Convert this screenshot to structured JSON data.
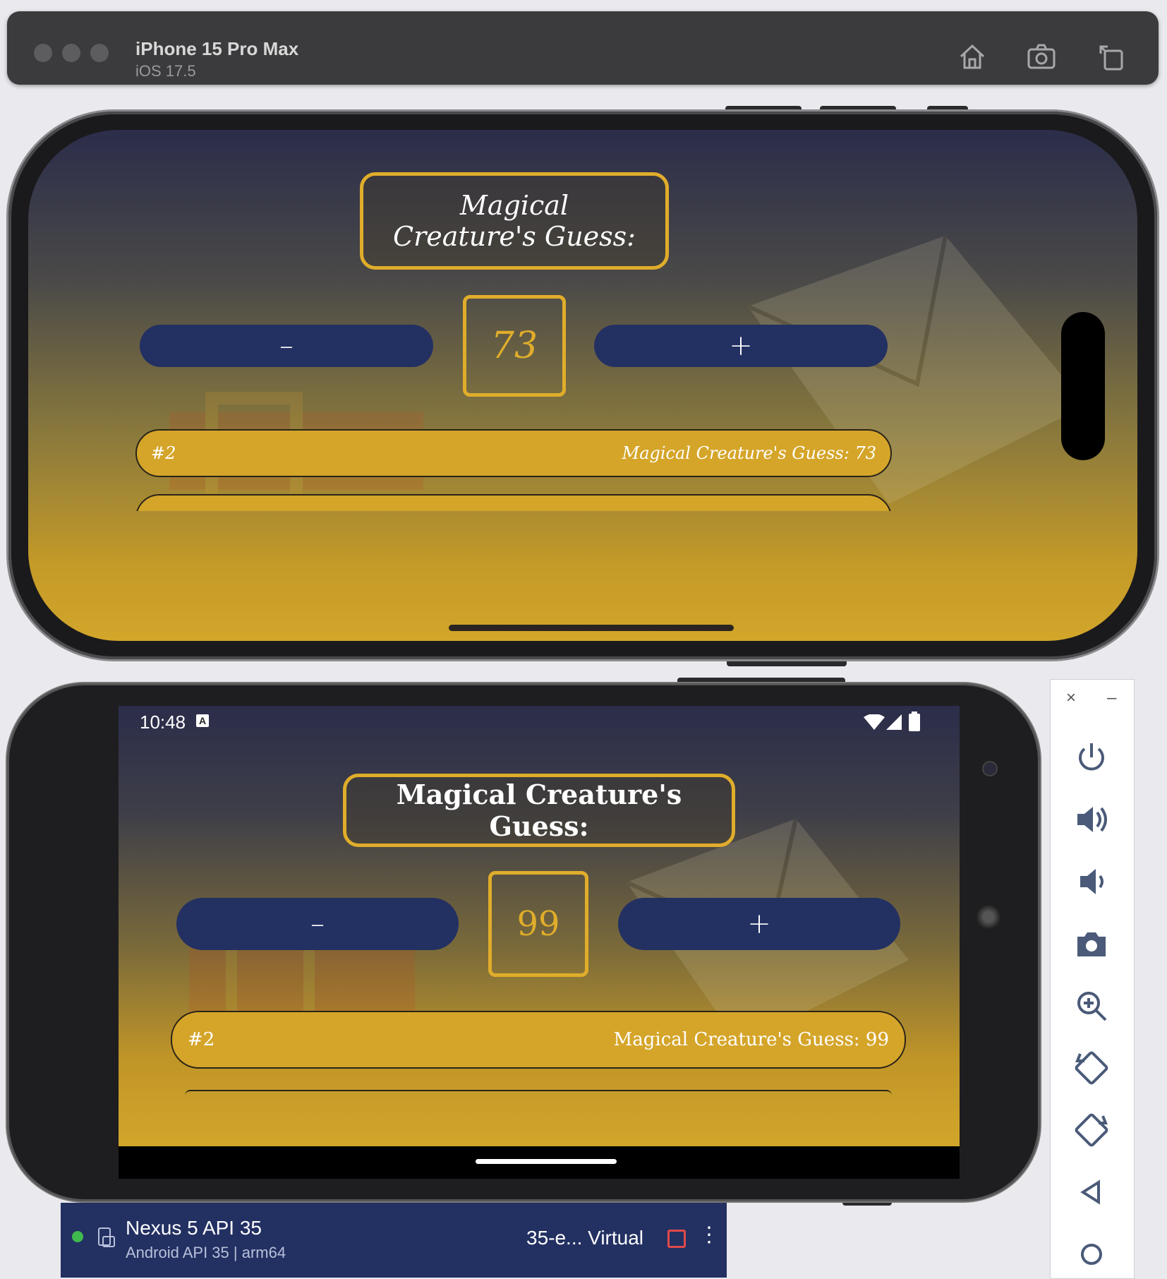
{
  "ios_window": {
    "device_name": "iPhone 15 Pro Max",
    "os_version": "iOS 17.5",
    "toolbar_icons": [
      "home-icon",
      "screenshot-icon",
      "rotate-icon"
    ]
  },
  "ios_app": {
    "title": "Magical Creature's Guess:",
    "minus_label": "–",
    "plus_label": "+",
    "current_guess": "73",
    "log": [
      {
        "index": "#2",
        "text": "Magical Creature's Guess: 73"
      }
    ]
  },
  "android_status": {
    "time": "10:48",
    "icons": [
      "a-icon",
      "wifi-icon",
      "signal-icon",
      "battery-icon"
    ]
  },
  "android_app": {
    "title": "Magical Creature's Guess:",
    "minus_label": "–",
    "plus_label": "+",
    "current_guess": "99",
    "log": [
      {
        "index": "#2",
        "text": "Magical Creature's Guess: 99"
      }
    ]
  },
  "emulator_toolbar": {
    "close_label": "×",
    "minimize_label": "–",
    "tools": [
      "power-icon",
      "volume-up-icon",
      "volume-down-icon",
      "camera-icon",
      "zoom-icon",
      "rotate-left-icon",
      "rotate-right-icon",
      "back-icon",
      "home-circle-icon"
    ]
  },
  "device_panel": {
    "name": "Nexus 5 API 35",
    "subtitle": "Android API 35 | arm64",
    "type": "35-e... Virtual"
  },
  "colors": {
    "navy": "#233062",
    "gold": "#e0ad2b",
    "row_gold": "#d5a52a",
    "running_green": "#3fba4f"
  }
}
